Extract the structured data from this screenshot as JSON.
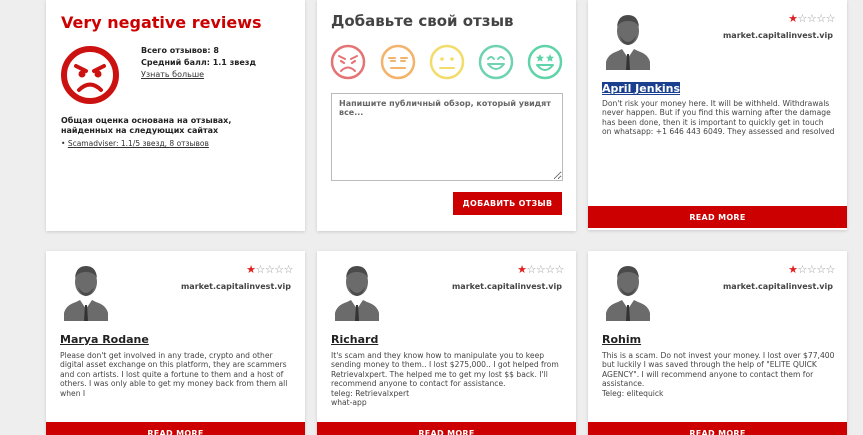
{
  "summary": {
    "title": "Very negative reviews",
    "total": "Всего отзывов: 8",
    "avg": "Средний балл: 1.1 звезд",
    "learn_more": "Узнать больше",
    "basis": "Общая оценка основана на отзывах, найденных на следующих сайтах",
    "sources": [
      "Scamadviser: 1.1/5 звезд, 8 отзывов"
    ],
    "face_icon": "angry-face-icon",
    "face_color": "#cc1111"
  },
  "add_review": {
    "title": "Добавьте свой отзыв",
    "emojis": [
      {
        "icon": "angry-emoji-icon",
        "color": "#e57373"
      },
      {
        "icon": "annoyed-emoji-icon",
        "color": "#f4b26a"
      },
      {
        "icon": "neutral-emoji-icon",
        "color": "#f3dc6b"
      },
      {
        "icon": "happy-emoji-icon",
        "color": "#6fd3b1"
      },
      {
        "icon": "star-eyes-emoji-icon",
        "color": "#5fd4a8"
      }
    ],
    "placeholder": "Напишите публичный обзор, который увидят все...",
    "submit_label": "ДОБАВИТЬ ОТЗЫВ"
  },
  "reviews": [
    {
      "name": "April Jenkins",
      "rating": 1,
      "max_rating": 5,
      "site": "market.capitalinvest.vip",
      "text": "Don't risk your money here. It will be withheld. Withdrawals never happen. But if you find this warning after the damage has been done, then it is important to quickly get in touch on whatsapp: +1 646 443 6049. They assessed and resolved",
      "more_label": "READ MORE"
    },
    {
      "name": "Marya Rodane",
      "rating": 1,
      "max_rating": 5,
      "site": "market.capitalinvest.vip",
      "text": "Please don't get involved in any trade, crypto and other digital asset exchange on this platform, they are scammers and con artists. I lost quite a fortune to them and a host of others. I was only able to get my money back from them all when I",
      "more_label": "READ MORE"
    },
    {
      "name": "Richard",
      "rating": 1,
      "max_rating": 5,
      "site": "market.capitalinvest.vip",
      "text": "It's scam and they know how to manipulate you to keep sending money to them.. I lost $275,000.. I got helped from Retrievalxpert. The helped me to get my lost $$ back. I'll recommend anyone to contact for assistance.\nteleg: Retrievalxpert\nwhat-app",
      "more_label": "READ MORE"
    },
    {
      "name": "Rohim",
      "rating": 1,
      "max_rating": 5,
      "site": "market.capitalinvest.vip",
      "text": "This is a scam. Do not invest your money. I lost over $77,400 but luckily I was saved through the help of \"ELITE QUICK AGENCY\". I will recommend anyone to contact them for assistance.\nTeleg: elitequick",
      "more_label": "READ MORE"
    }
  ]
}
